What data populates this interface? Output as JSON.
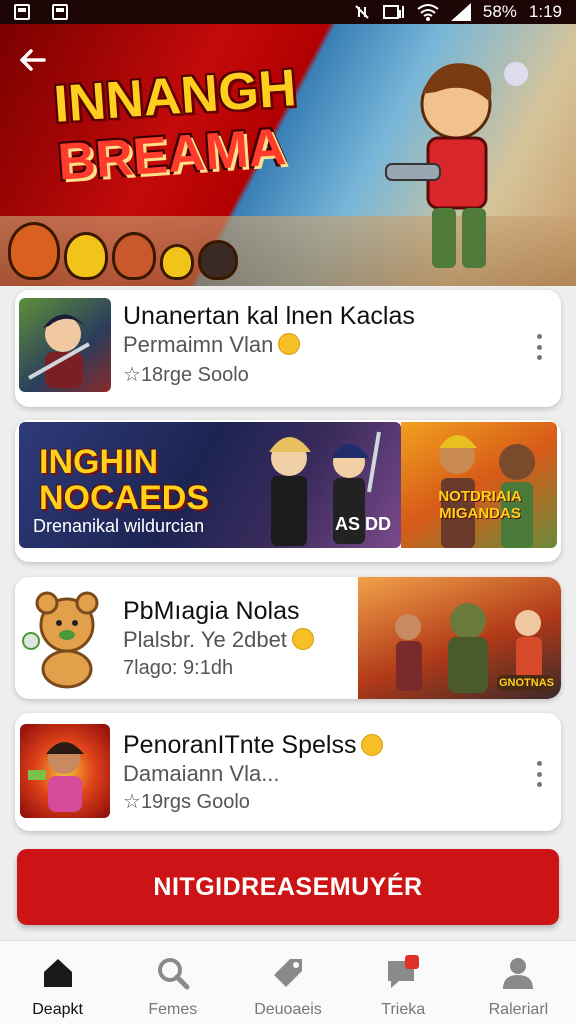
{
  "status_bar": {
    "battery": "58%",
    "time": "1:19"
  },
  "hero": {
    "title_line1": "INNANGH",
    "title_line2": "BREAMA"
  },
  "cards": [
    {
      "title": "Unanertan kal lnen Kaclas",
      "subtitle": "Permaimn Vlan",
      "meta": "18rge Soolo"
    },
    {
      "banner_logo": "INGHIN NOCAEDS",
      "banner_caption": "Drenanikal wildurcian",
      "banner_price": "AS DD",
      "banner_side_label": "NOTDRIAIA MIGANDAS"
    },
    {
      "title": "PbMıagia Nolas",
      "subtitle": "Plalsbr. Ye 2dbet",
      "meta": "7lago: 9:1dh",
      "thumb_badge": "GNOTNAS"
    },
    {
      "title": "PenoranITnte Spelss",
      "subtitle": "Damaiann Vla...",
      "meta": "19rgs Goolo"
    }
  ],
  "cta": {
    "label": "NITGIDREASEMUYÉR"
  },
  "bottom_nav": [
    {
      "label": "Deapkt",
      "icon": "home-icon",
      "active": true
    },
    {
      "label": "Femes",
      "icon": "search-icon",
      "active": false
    },
    {
      "label": "Deuoaeis",
      "icon": "tag-icon",
      "active": false
    },
    {
      "label": "Trieka",
      "icon": "chat-icon",
      "active": false
    },
    {
      "label": "Raleriarl",
      "icon": "profile-icon",
      "active": false
    }
  ],
  "colors": {
    "accent": "#cc1316",
    "hero_red": "#c40a0a",
    "background": "#efefef"
  }
}
